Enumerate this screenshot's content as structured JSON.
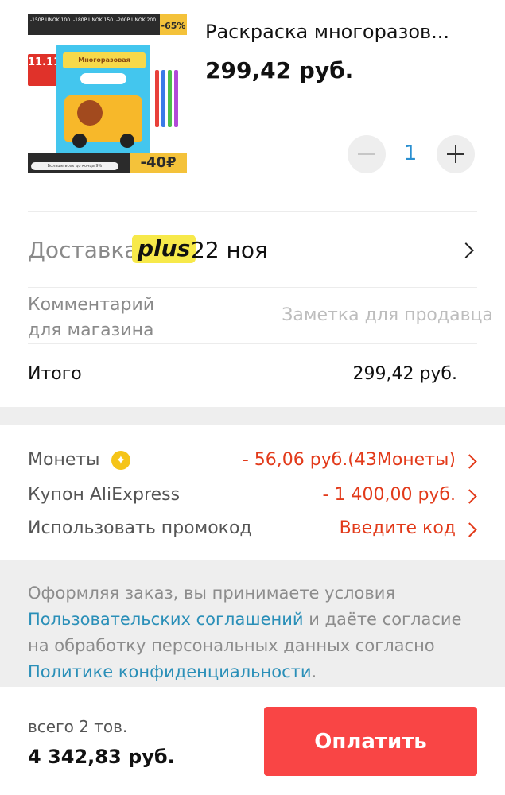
{
  "product": {
    "title": "Раскраска многоразов...",
    "price": "299,42 руб.",
    "quantity": "1",
    "image": {
      "top_labels": [
        "-150P UNOK 100",
        "-180P UNOK 150",
        "-200P UNOK 200"
      ],
      "sale_badge": "-65%",
      "badge_11": "11.11",
      "book_title": "Многоразовая",
      "bottom_tag": "-40₽",
      "bottom_pill": "Больше всех до конца 9%"
    }
  },
  "delivery": {
    "label": "Доставка",
    "plus_label": "plus",
    "date": "22 ноя"
  },
  "comment": {
    "label_line1": "Комментарий",
    "label_line2": "для магазина",
    "placeholder": "Заметка для продавца"
  },
  "total": {
    "label": "Итого",
    "value": "299,42 руб."
  },
  "discounts": {
    "coins_label": "Монеты",
    "coins_value": "- 56,06 руб.(43Монеты)",
    "coupon_label": "Купон AliExpress",
    "coupon_value": "- 1 400,00 руб.",
    "promo_label": "Использовать промокод",
    "promo_value": "Введите код"
  },
  "terms": {
    "text_1": "Оформляя заказ, вы принимаете условия ",
    "link_1": "Пользовательских соглашений",
    "text_2": " и даёте согласие на обработку персональных данных согласно ",
    "link_2": "Политике конфиденциальности",
    "text_3": "."
  },
  "footer": {
    "count": "всего 2 тов.",
    "sum": "4 342,83 руб.",
    "pay_label": "Оплатить"
  },
  "colors": {
    "accent_red": "#f94545",
    "discount_red": "#e23a1a",
    "link_blue": "#2a8fb8",
    "plus_yellow": "#f7e94a",
    "coin_yellow": "#f5c418"
  }
}
